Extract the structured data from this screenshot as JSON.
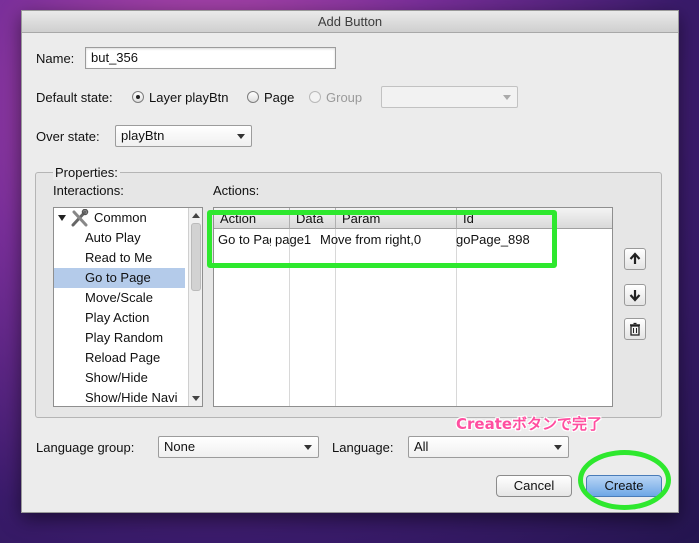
{
  "window": {
    "title": "Add Button"
  },
  "name_field": {
    "label": "Name:",
    "value": "but_356"
  },
  "default_state": {
    "label": "Default state:",
    "options": [
      {
        "label": "Layer playBtn",
        "selected": true,
        "disabled": false
      },
      {
        "label": "Page",
        "selected": false,
        "disabled": false
      },
      {
        "label": "Group",
        "selected": false,
        "disabled": true
      }
    ],
    "group_select_value": ""
  },
  "over_state": {
    "label": "Over state:",
    "value": "playBtn"
  },
  "properties": {
    "label": "Properties:",
    "interactions_label": "Interactions:",
    "actions_label": "Actions:",
    "category": "Common",
    "interactions": [
      {
        "label": "Auto Play",
        "selected": false
      },
      {
        "label": "Read to Me",
        "selected": false
      },
      {
        "label": "Go to Page",
        "selected": true
      },
      {
        "label": "Move/Scale",
        "selected": false
      },
      {
        "label": "Play Action",
        "selected": false
      },
      {
        "label": "Play Random",
        "selected": false
      },
      {
        "label": "Reload Page",
        "selected": false
      },
      {
        "label": "Show/Hide",
        "selected": false
      },
      {
        "label": "Show/Hide Navi",
        "selected": false
      }
    ],
    "actions_table": {
      "columns": [
        "Action",
        "Data",
        "Param",
        "Id"
      ],
      "rows": [
        [
          "Go to Page",
          "page1",
          "Move from right,0",
          "goPage_898"
        ]
      ]
    }
  },
  "side_buttons": {
    "up": "move-up",
    "down": "move-down",
    "delete": "trash"
  },
  "language_group": {
    "label": "Language group:",
    "value": "None"
  },
  "language": {
    "label": "Language:",
    "value": "All"
  },
  "buttons": {
    "cancel": "Cancel",
    "create": "Create"
  },
  "annotation": {
    "text": "Createボタンで完了",
    "color": "#ff4fa0",
    "highlight_color": "#2ee82e"
  }
}
